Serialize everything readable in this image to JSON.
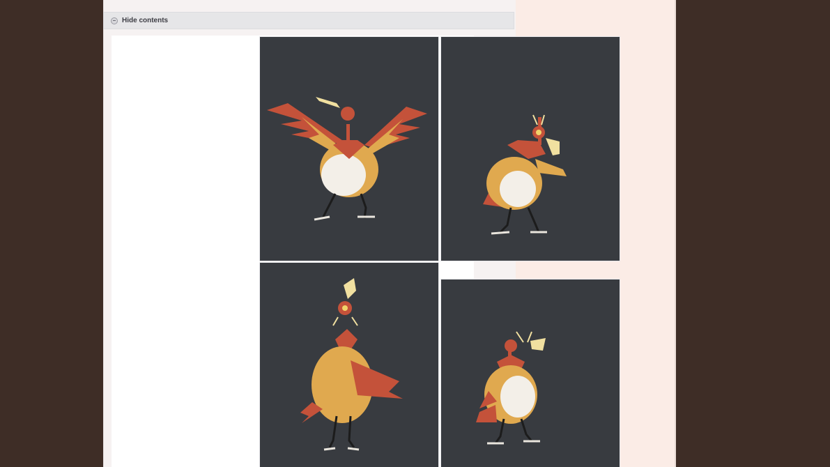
{
  "spoiler": {
    "toggle_label": "Hide contents"
  },
  "gallery": {
    "items": [
      {
        "pose": "wings-spread-front",
        "icon": "bird-creature-image"
      },
      {
        "pose": "side-facing-right",
        "icon": "bird-creature-image"
      },
      {
        "pose": "back-view",
        "icon": "bird-creature-image"
      },
      {
        "pose": "side-facing-left",
        "icon": "bird-creature-image"
      }
    ]
  },
  "colors": {
    "outer_background": "#3e2d26",
    "page_background": "#fbece6",
    "tile_background": "#383b40",
    "feather_orange": "#e0a94f",
    "feather_red": "#c4523a",
    "belly_white": "#f3efe8"
  }
}
